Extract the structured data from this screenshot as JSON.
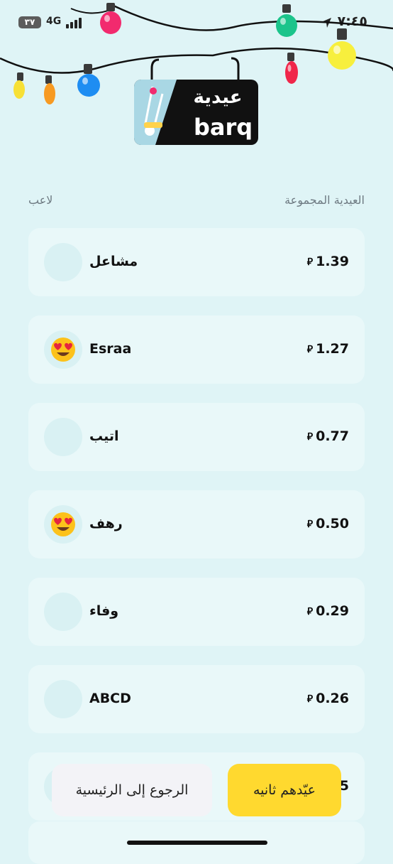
{
  "status_bar": {
    "time": "٧:٤٥",
    "network": "4G",
    "battery": "٣٧"
  },
  "logo": {
    "arabic": "عيدية",
    "wordmark": "barq"
  },
  "headers": {
    "player": "لاعب",
    "total": "العيدية المجموعة"
  },
  "currency_symbol": "⃁",
  "players": [
    {
      "name": "مشاعل",
      "amount": "1.39",
      "emoji": ""
    },
    {
      "name": "Esraa",
      "amount": "1.27",
      "emoji": "heart-eyes"
    },
    {
      "name": "اتيب",
      "amount": "0.77",
      "emoji": ""
    },
    {
      "name": "رهف",
      "amount": "0.50",
      "emoji": "heart-eyes"
    },
    {
      "name": "وفاء",
      "amount": "0.29",
      "emoji": ""
    },
    {
      "name": "ABCD",
      "amount": "0.26",
      "emoji": ""
    },
    {
      "name": "",
      "amount": "5",
      "emoji": ""
    }
  ],
  "buttons": {
    "home": "الرجوع إلى الرئيسية",
    "play_again": "عيّدهم ثانيه"
  },
  "colors": {
    "background": "#dff4f6",
    "card": "#e9f8f9",
    "primary_button": "#ffd92f",
    "secondary_button": "#f3f3f7"
  }
}
